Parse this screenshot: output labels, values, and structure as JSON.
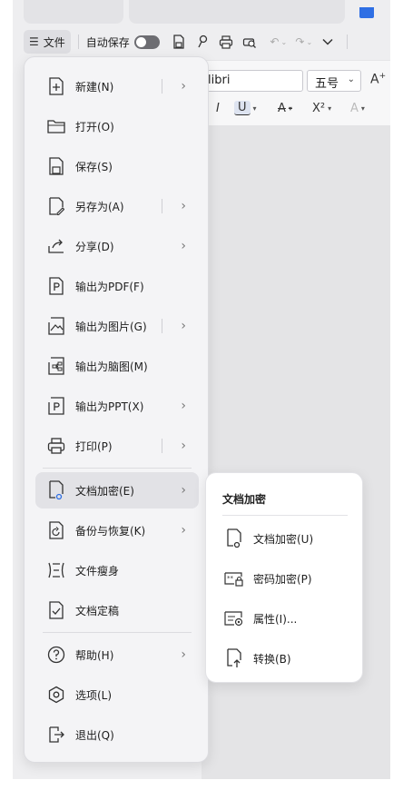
{
  "toolbar": {
    "menu_label": "文件",
    "autosave_label": "自动保存"
  },
  "ribbon": {
    "font_name": "libri",
    "font_size": "五号",
    "superscript": "X²"
  },
  "menu": {
    "items": [
      {
        "label": "新建(N)"
      },
      {
        "label": "打开(O)"
      },
      {
        "label": "保存(S)"
      },
      {
        "label": "另存为(A)"
      },
      {
        "label": "分享(D)"
      },
      {
        "label": "输出为PDF(F)"
      },
      {
        "label": "输出为图片(G)"
      },
      {
        "label": "输出为脑图(M)"
      },
      {
        "label": "输出为PPT(X)"
      },
      {
        "label": "打印(P)"
      },
      {
        "label": "文档加密(E)"
      },
      {
        "label": "备份与恢复(K)"
      },
      {
        "label": "文件瘦身"
      },
      {
        "label": "文档定稿"
      },
      {
        "label": "帮助(H)"
      },
      {
        "label": "选项(L)"
      },
      {
        "label": "退出(Q)"
      }
    ]
  },
  "submenu": {
    "title": "文档加密",
    "items": [
      {
        "label": "文档加密(U)"
      },
      {
        "label": "密码加密(P)"
      },
      {
        "label": "属性(I)..."
      },
      {
        "label": "转换(B)"
      }
    ]
  },
  "colors": {
    "accent": "#2f6fe4",
    "menu_bg": "#f4f4f6",
    "active_bg": "#e2e2e6"
  }
}
